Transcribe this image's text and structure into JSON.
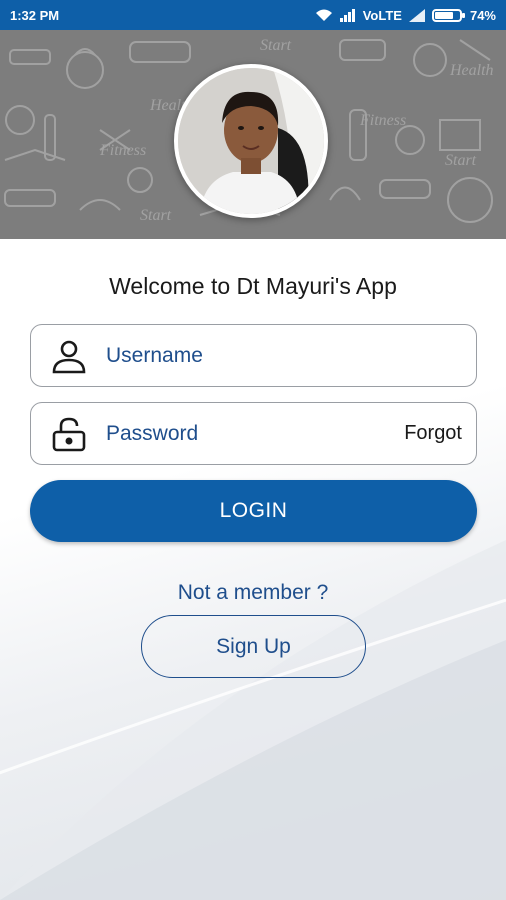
{
  "status_bar": {
    "time": "1:32 PM",
    "network": "VoLTE",
    "battery_text": "74%",
    "battery_level": 0.74,
    "icons": [
      "wifi-icon",
      "signal-icon",
      "signal-icon",
      "battery-icon"
    ]
  },
  "header": {
    "background_color": "#7d7d7d",
    "avatar_icon": "profile-photo"
  },
  "welcome_text": "Welcome to Dt Mayuri's App",
  "username": {
    "placeholder": "Username",
    "value": "",
    "icon": "user-icon"
  },
  "password": {
    "placeholder": "Password",
    "value": "",
    "icon": "lock-icon",
    "forgot_label": "Forgot"
  },
  "login_label": "LOGIN",
  "not_member_text": "Not a member ?",
  "signup_label": "Sign Up",
  "colors": {
    "primary": "#0e5fa8",
    "text_blue": "#1f4e8c"
  }
}
